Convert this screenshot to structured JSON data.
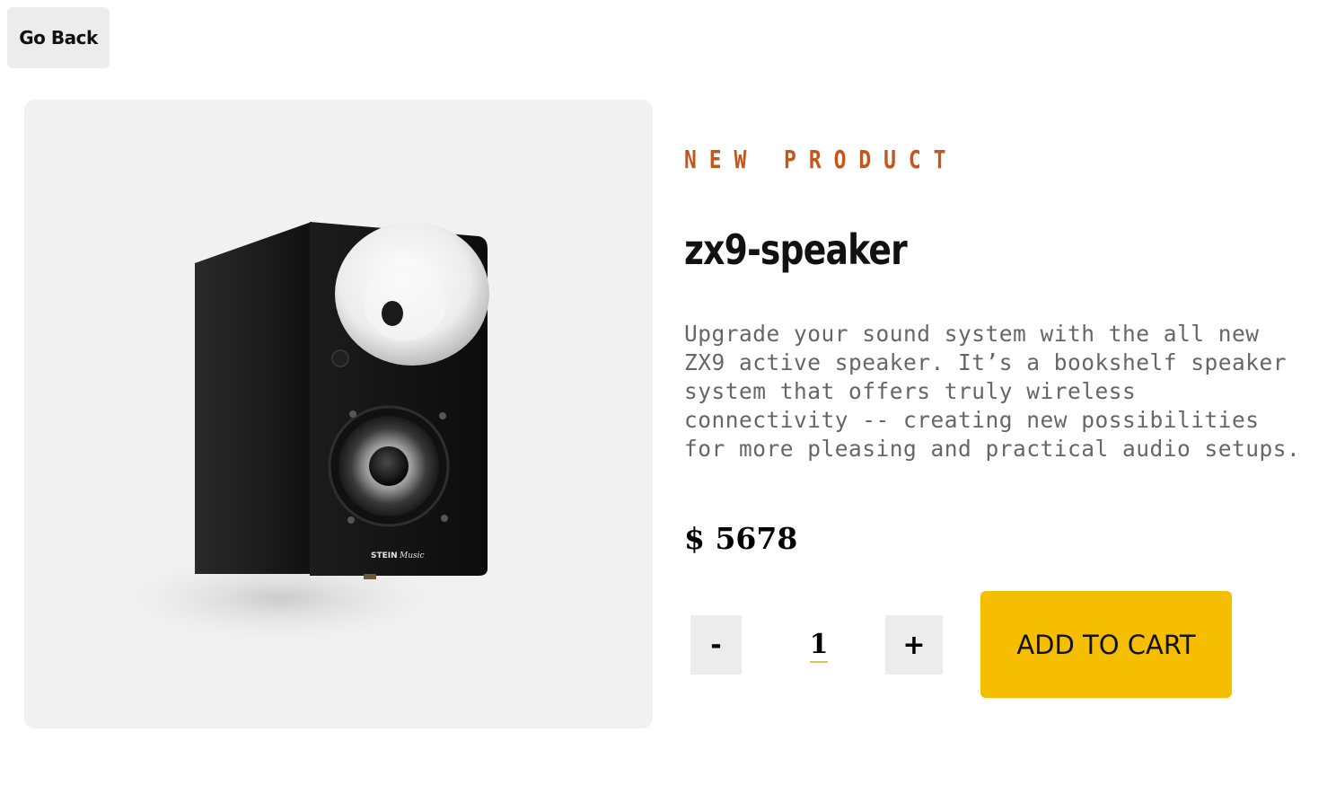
{
  "nav": {
    "back_label": "Go Back"
  },
  "product": {
    "overline": "NEW PRODUCT",
    "name": "zx9-speaker",
    "description": "Upgrade your sound system with the all new ZX9 active speaker. It’s a bookshelf speaker system that offers truly wireless connectivity -- creating new possibilities for more pleasing and practical audio setups.",
    "price": "$ 5678",
    "image_brand_logo": "STEIN Music"
  },
  "cart": {
    "decrement_label": "-",
    "quantity": "1",
    "increment_label": "+",
    "add_label": "ADD TO CART"
  },
  "colors": {
    "accent": "#c4551b",
    "cta": "#f6be00",
    "panel_bg": "#f1f1f1",
    "button_bg": "#ececec"
  }
}
